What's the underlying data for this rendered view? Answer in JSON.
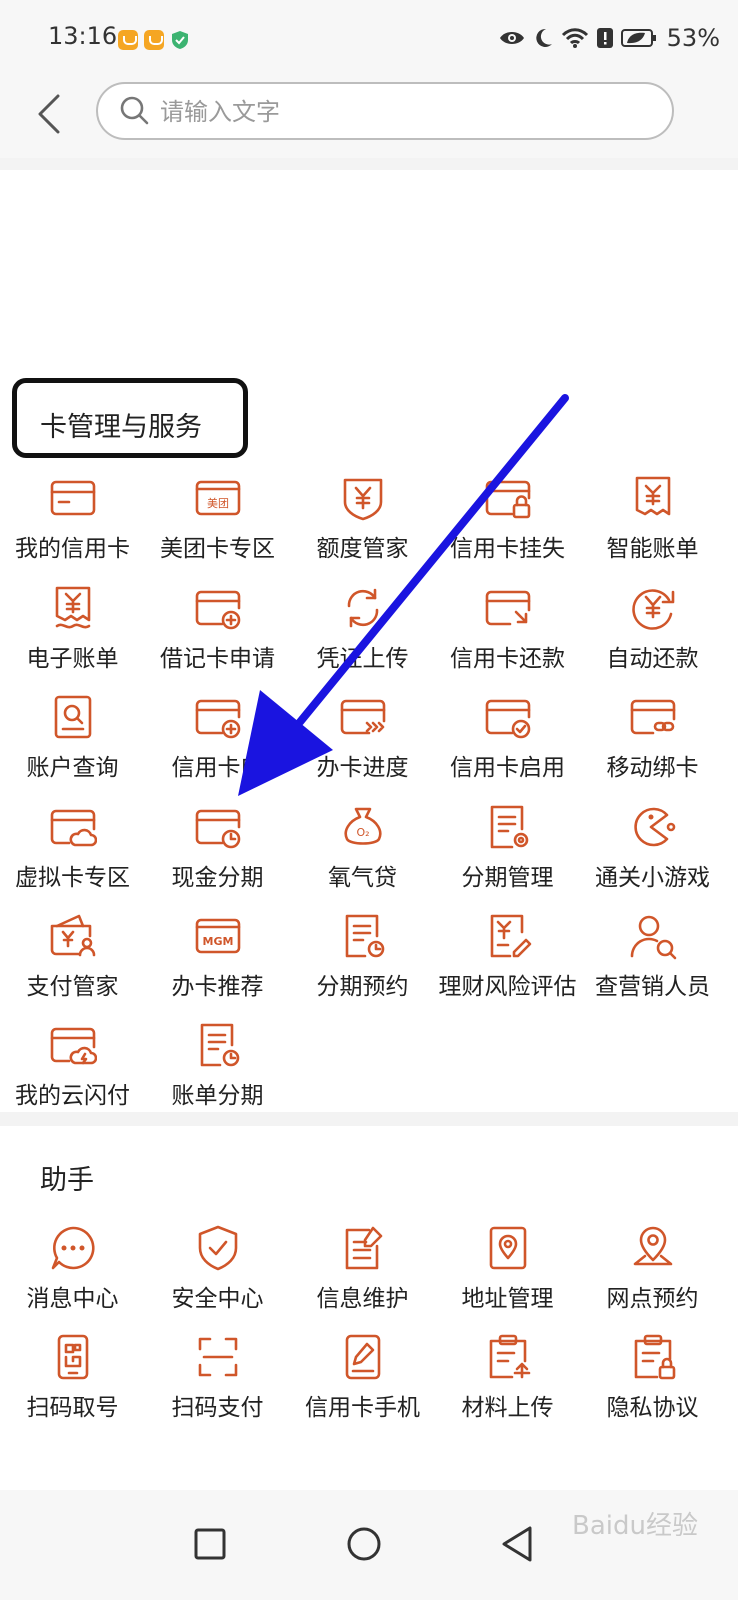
{
  "status_bar": {
    "time": "13:16",
    "battery": "53%",
    "icons": [
      "app-badge-icon",
      "app-badge-icon",
      "shield-check-icon",
      "eye-icon",
      "moon-icon",
      "wifi-icon",
      "alert-icon",
      "battery-icon"
    ]
  },
  "header": {
    "back_icon": "back-arrow-icon",
    "search_placeholder": "请输入文字"
  },
  "sections": [
    {
      "title": "卡管理与服务",
      "items": [
        {
          "label": "我的信用卡",
          "icon": "card-icon"
        },
        {
          "label": "美团卡专区",
          "icon": "meituan-card-icon"
        },
        {
          "label": "额度管家",
          "icon": "yuan-shield-icon"
        },
        {
          "label": "信用卡挂失",
          "icon": "card-lock-icon"
        },
        {
          "label": "智能账单",
          "icon": "smart-bill-icon"
        },
        {
          "label": "电子账单",
          "icon": "e-bill-icon"
        },
        {
          "label": "借记卡申请",
          "icon": "card-add-icon"
        },
        {
          "label": "凭证上传",
          "icon": "refresh-icon"
        },
        {
          "label": "信用卡还款",
          "icon": "card-repay-icon"
        },
        {
          "label": "自动还款",
          "icon": "auto-repay-icon"
        },
        {
          "label": "账户查询",
          "icon": "account-search-icon"
        },
        {
          "label": "信用卡申",
          "icon": "card-add-icon"
        },
        {
          "label": "办卡进度",
          "icon": "card-progress-icon"
        },
        {
          "label": "信用卡启用",
          "icon": "card-check-icon"
        },
        {
          "label": "移动绑卡",
          "icon": "card-link-icon"
        },
        {
          "label": "虚拟卡专区",
          "icon": "card-cloud-icon"
        },
        {
          "label": "现金分期",
          "icon": "card-clock-icon"
        },
        {
          "label": "氧气贷",
          "icon": "o2-bag-icon"
        },
        {
          "label": "分期管理",
          "icon": "doc-gear-icon"
        },
        {
          "label": "通关小游戏",
          "icon": "pacman-icon"
        },
        {
          "label": "支付管家",
          "icon": "wallet-user-icon"
        },
        {
          "label": "办卡推荐",
          "icon": "mgm-card-icon"
        },
        {
          "label": "分期预约",
          "icon": "doc-clock-icon"
        },
        {
          "label": "理财风险评估",
          "icon": "doc-edit-icon"
        },
        {
          "label": "查营销人员",
          "icon": "user-search-icon"
        },
        {
          "label": "我的云闪付",
          "icon": "card-flash-icon"
        },
        {
          "label": "账单分期",
          "icon": "doc-clock-icon"
        }
      ]
    },
    {
      "title": "助手",
      "items": [
        {
          "label": "消息中心",
          "icon": "message-icon"
        },
        {
          "label": "安全中心",
          "icon": "shield-icon"
        },
        {
          "label": "信息维护",
          "icon": "doc-pen-icon"
        },
        {
          "label": "地址管理",
          "icon": "map-doc-icon"
        },
        {
          "label": "网点预约",
          "icon": "location-pin-icon"
        },
        {
          "label": "扫码取号",
          "icon": "qr-phone-icon"
        },
        {
          "label": "扫码支付",
          "icon": "scan-icon"
        },
        {
          "label": "信用卡手机",
          "icon": "phone-pen-icon"
        },
        {
          "label": "材料上传",
          "icon": "clipboard-upload-icon"
        },
        {
          "label": "隐私协议",
          "icon": "clipboard-lock-icon"
        }
      ]
    }
  ],
  "annotation": {
    "color": "#1a14e0"
  },
  "nav_bar": {
    "icons": [
      "recent-apps-icon",
      "home-icon",
      "back-icon"
    ]
  },
  "watermark": "Baidu经验",
  "accent_color": "#d0562a"
}
